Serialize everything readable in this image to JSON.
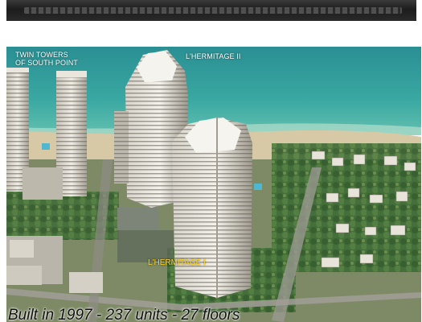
{
  "banner": {
    "text": ""
  },
  "photo": {
    "labels": {
      "twin_towers_line1": "TWIN TOWERS",
      "twin_towers_line2": "OF SOUTH POINT",
      "hermitage_ii": "L'HERMITAGE II",
      "hermitage_i": "L'HERMITAGE I"
    },
    "caption": "Built in 1997 - 237 units - 27 floors",
    "colors": {
      "ocean": "#2f9c9a",
      "sand": "#d8c9a6",
      "label_accent": "#ffd92e"
    }
  }
}
